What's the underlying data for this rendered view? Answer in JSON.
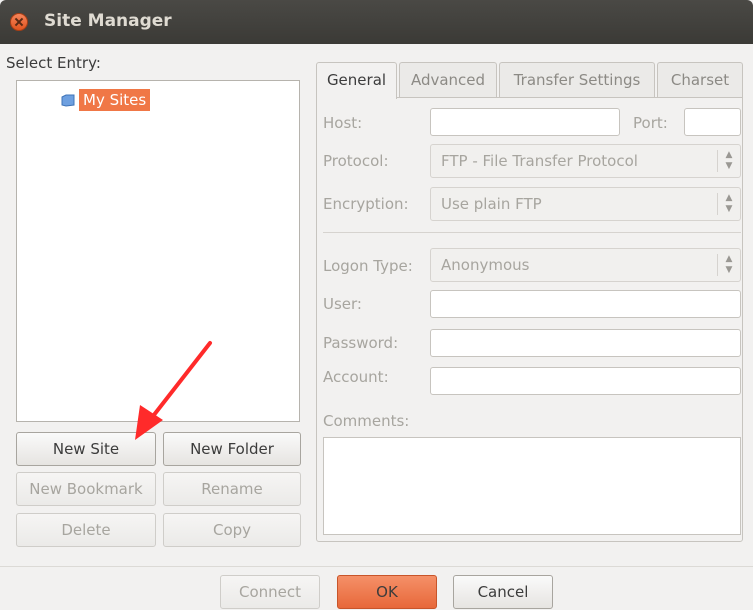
{
  "window": {
    "title": "Site Manager"
  },
  "left": {
    "select_entry_label": "Select Entry:",
    "tree_root": "My Sites",
    "buttons": {
      "new_site": "New Site",
      "new_folder": "New Folder",
      "new_bookmark": "New Bookmark",
      "rename": "Rename",
      "delete": "Delete",
      "copy": "Copy"
    }
  },
  "tabs": [
    "General",
    "Advanced",
    "Transfer Settings",
    "Charset"
  ],
  "general": {
    "host_label": "Host:",
    "host_value": "",
    "port_label": "Port:",
    "port_value": "",
    "protocol_label": "Protocol:",
    "protocol_value": "FTP - File Transfer Protocol",
    "encryption_label": "Encryption:",
    "encryption_value": "Use plain FTP",
    "logon_type_label": "Logon Type:",
    "logon_type_value": "Anonymous",
    "user_label": "User:",
    "password_label": "Password:",
    "account_label": "Account:",
    "comments_label": "Comments:"
  },
  "footer": {
    "connect": "Connect",
    "ok": "OK",
    "cancel": "Cancel"
  },
  "colors": {
    "accent": "#f07746",
    "titlebar": "#3c3b37",
    "annotation_arrow": "#ff2a2a"
  },
  "annotation": {
    "arrow_target": "new-site-button"
  }
}
